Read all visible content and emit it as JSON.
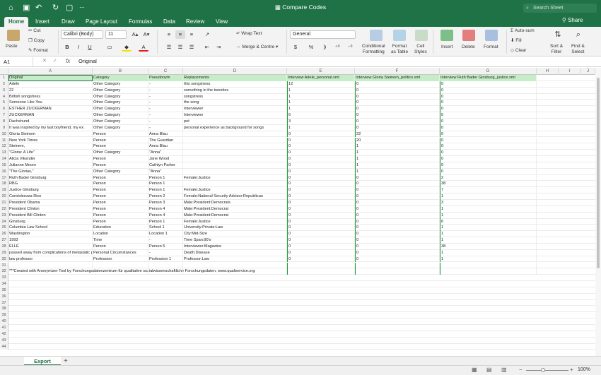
{
  "window": {
    "title": "Compare Codes",
    "search_placeholder": "Search Sheet"
  },
  "tabs": [
    "Home",
    "Insert",
    "Draw",
    "Page Layout",
    "Formulas",
    "Data",
    "Review",
    "View"
  ],
  "share_label": "Share",
  "ribbon": {
    "paste": "Paste",
    "cut": "Cut",
    "copy": "Copy",
    "format": "Format",
    "font_name": "Calibri (Body)",
    "font_size": "11",
    "wrap_text": "Wrap Text",
    "merge_centre": "Merge & Centre",
    "number_format": "General",
    "percent": "%",
    "conditional_formatting": [
      "Conditional",
      "Formatting"
    ],
    "format_as_table": [
      "Format",
      "as Table"
    ],
    "cell_styles": [
      "Cell",
      "Styles"
    ],
    "insert": "Insert",
    "delete": "Delete",
    "format_cells": "Format",
    "autosum": "Auto-sum",
    "fill": "Fill",
    "clear": "Clear",
    "sort_filter": [
      "Sort &",
      "Filter"
    ],
    "find_select": [
      "Find &",
      "Select"
    ]
  },
  "formula_bar": {
    "cell_ref": "A1",
    "fx": "fx",
    "value": "Original"
  },
  "columns": [
    "A",
    "B",
    "C",
    "D",
    "E",
    "F",
    "G",
    "H",
    "I",
    "J"
  ],
  "rows": [
    [
      "Original",
      "Category",
      "Pseudonym",
      "Replacements",
      "Interview Adele_personal.xml",
      "Interview Gloria Steinem_politics.xml",
      "Interview Ruth Bader Ginsburg_justice.xml"
    ],
    [
      "Adele",
      "Other Category",
      "-",
      "this songstress",
      "12",
      "0",
      "0"
    ],
    [
      "22",
      "Other Category",
      "-",
      "something in the twenties",
      "1",
      "0",
      "0"
    ],
    [
      "British songstress",
      "Other Category",
      "-",
      "songstress",
      "1",
      "0",
      "0"
    ],
    [
      "Someone Like You",
      "Other Category",
      "-",
      "the song",
      "1",
      "0",
      "0"
    ],
    [
      "ESTHER ZUCKERMAN",
      "Other Category",
      "-",
      "Interviewer",
      "1",
      "0",
      "0"
    ],
    [
      "ZUCKERMAN",
      "Other Category",
      "-",
      "Interviewer",
      "6",
      "0",
      "0"
    ],
    [
      "Dachshund",
      "Other Category",
      "-",
      "pet",
      "3",
      "0",
      "0"
    ],
    [
      "It was inspired by my last boyfriend, my ex.",
      "Other Category",
      "-",
      "personal experience as background for songs",
      "1",
      "0",
      "0"
    ],
    [
      "Gloria Steinem",
      "Person",
      "Anna Blau",
      "",
      "0",
      "22",
      "0"
    ],
    [
      "New York Times",
      "Person",
      "The Guardian",
      "",
      "0",
      "20",
      "0"
    ],
    [
      "Steinem,",
      "Person",
      "Anna Blau",
      "",
      "0",
      "1",
      "0"
    ],
    [
      "\"Gloria: A Life\"",
      "Other Category",
      "\"Anna\"",
      "",
      "0",
      "1",
      "0"
    ],
    [
      "Alicia Vikander",
      "Person",
      "Jane Wood",
      "",
      "0",
      "1",
      "0"
    ],
    [
      "Julianne Moore",
      "Person",
      "Cathlyn Parker",
      "",
      "0",
      "1",
      "0"
    ],
    [
      "\"The Glorias,\"",
      "Other Category",
      "\"Anna\"",
      "",
      "0",
      "1",
      "0"
    ],
    [
      "Ruth Bader Ginsburg",
      "Person",
      "Person 1",
      "Female:Justice",
      "0",
      "0",
      "2"
    ],
    [
      "RBG",
      "Person",
      "Person 1",
      "",
      "0",
      "0",
      "38"
    ],
    [
      "Justice Ginsburg",
      "Person",
      "Person 1",
      "Female:Justice",
      "0",
      "0",
      "7"
    ],
    [
      "Condoleezza Rice",
      "Person",
      "Person 2",
      "Female:National Security Advisor:Republican",
      "0",
      "0",
      "1"
    ],
    [
      "President Obama",
      "Person",
      "Person 3",
      "Male:President:Democrats",
      "0",
      "0",
      "3"
    ],
    [
      "President Clinton",
      "Person",
      "Person 4",
      "Male:President:Democrat",
      "0",
      "0",
      "1"
    ],
    [
      "President Bill Clinton",
      "Person",
      "Person 4",
      "Male:President:Democrat",
      "0",
      "0",
      "1"
    ],
    [
      "Ginsburg",
      "Person",
      "Person 1",
      "Female:Justice",
      "0",
      "0",
      "6"
    ],
    [
      "Columbia Law School",
      "Education",
      "School 1",
      "University:Private:Law",
      "0",
      "0",
      "1"
    ],
    [
      "Washington",
      "Location",
      "Location 1",
      "City:Mid-Size",
      "0",
      "0",
      "1"
    ],
    [
      "1993",
      "Time",
      "-",
      "Time Span:90's",
      "0",
      "0",
      "1"
    ],
    [
      "ELLE",
      "Person",
      "Person 5",
      "Interviewer:Magazine",
      "0",
      "0",
      "38"
    ],
    [
      "passed away from complications of metastatic pancreas cancer",
      "Personal Circumstances",
      "-",
      "Death:Disease",
      "0",
      "0",
      "1"
    ],
    [
      "law professor",
      "Profession",
      "Profession 1",
      "Professor:Law",
      "0",
      "0",
      "1"
    ],
    [
      "",
      "",
      "",
      "",
      "",
      "",
      ""
    ],
    [
      "***Created with Anonymizer Tool by Forschungsdatenzentrum für qualitative sozialwissenschaftliche Forschungsdaten, www.qualiservice.org",
      "",
      "",
      "",
      "",
      "",
      ""
    ]
  ],
  "sheet_tab": "Export",
  "zoom": "100%"
}
